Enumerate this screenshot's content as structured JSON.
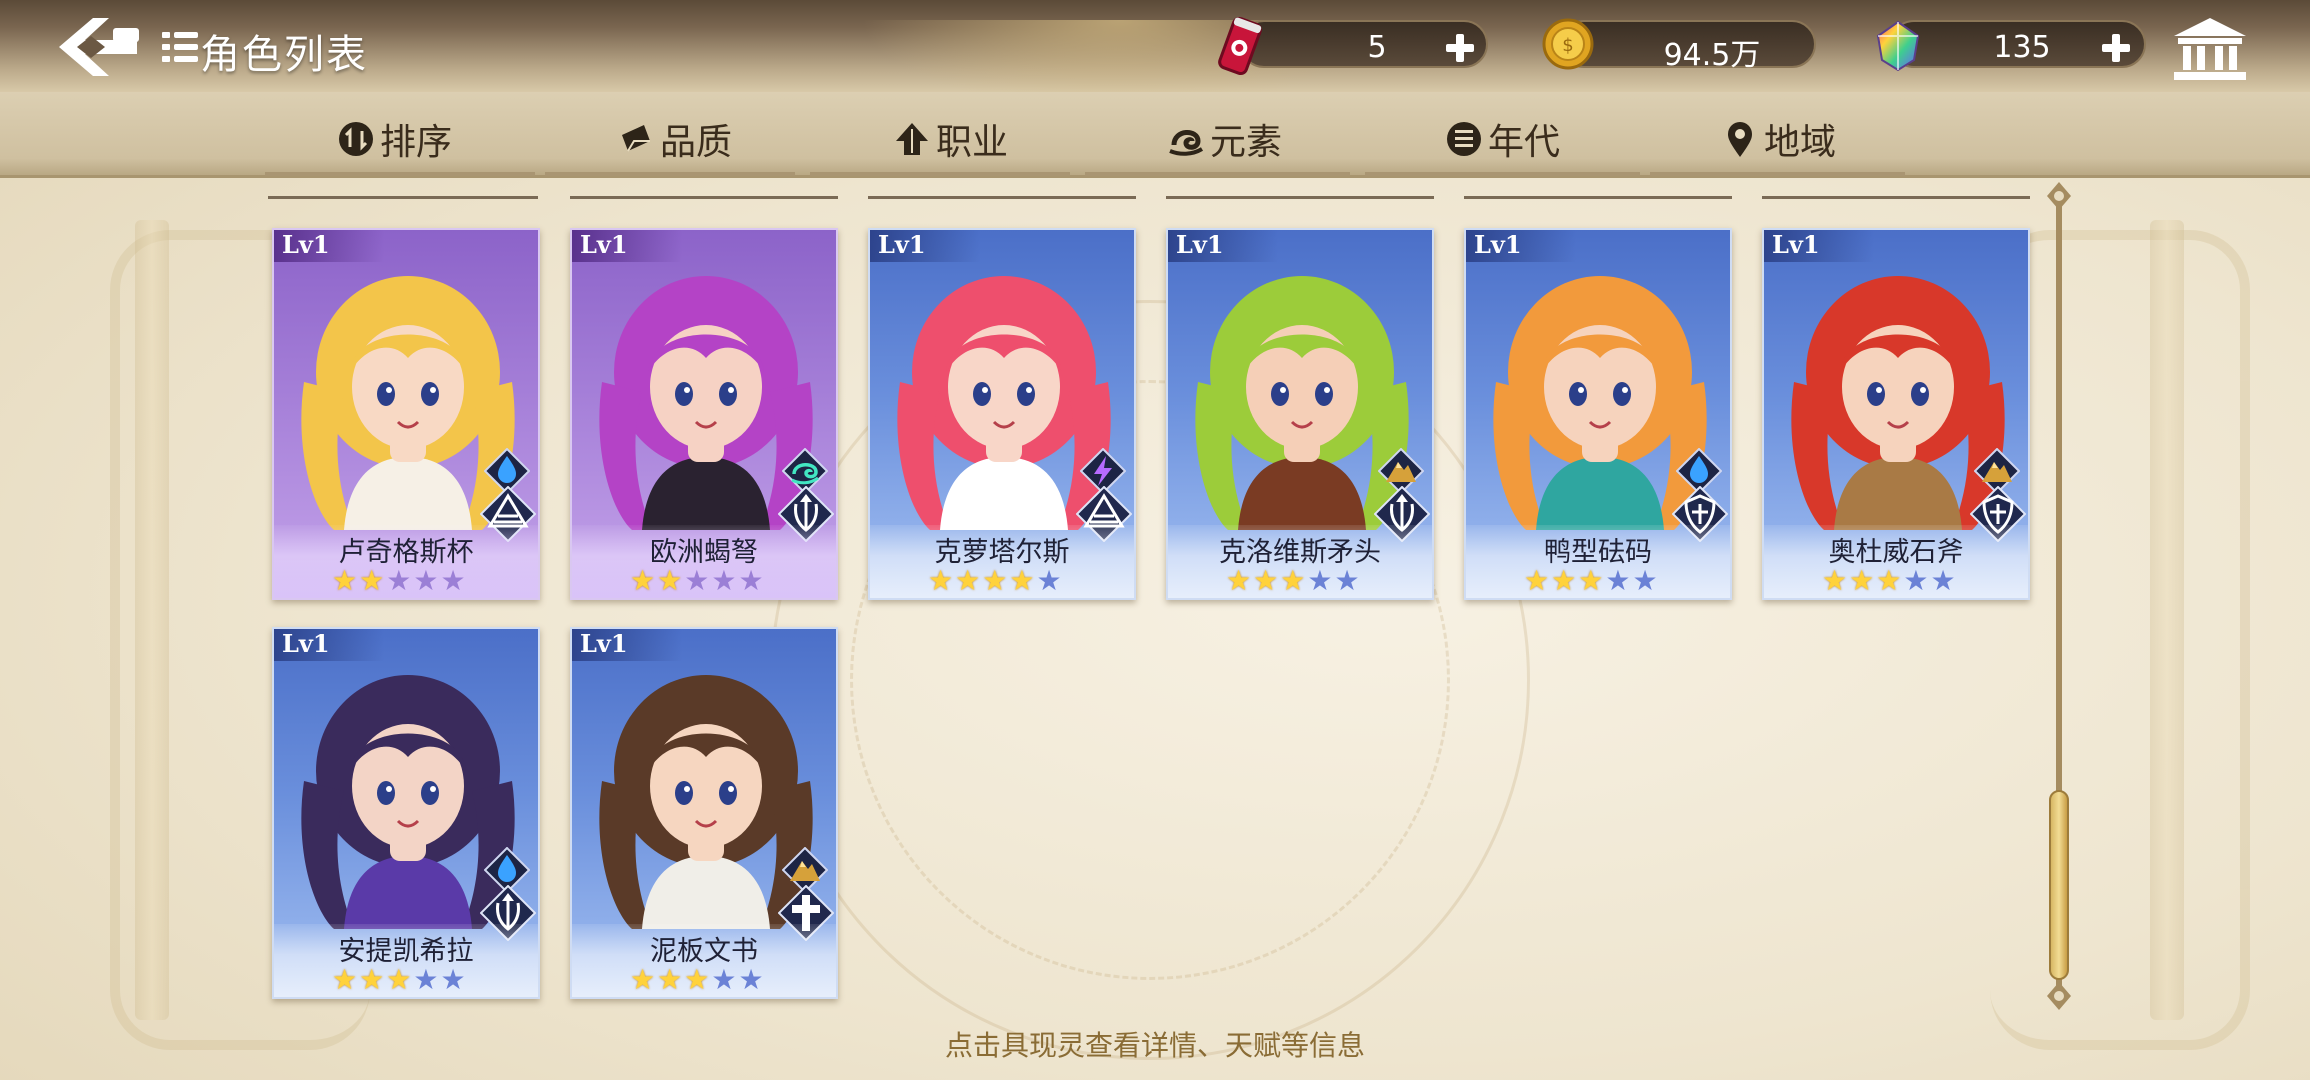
{
  "header": {
    "title": "角色列表",
    "resources": [
      {
        "name": "energy-drink",
        "value": "5"
      },
      {
        "name": "gold-coin",
        "value": "94.5万"
      },
      {
        "name": "gem",
        "value": "135"
      }
    ]
  },
  "filters": [
    {
      "label": "排序",
      "icon": "sort-icon"
    },
    {
      "label": "品质",
      "icon": "quality-icon"
    },
    {
      "label": "职业",
      "icon": "job-icon"
    },
    {
      "label": "元素",
      "icon": "element-icon"
    },
    {
      "label": "年代",
      "icon": "era-icon"
    },
    {
      "label": "地域",
      "icon": "region-location-icon"
    }
  ],
  "cards": [
    {
      "level": "Lv1",
      "name": "卢奇格斯杯",
      "stars": 2,
      "max_stars": 5,
      "rarity": "purple",
      "element": "water-drop-icon",
      "job": "mage-hat-icon",
      "hair": "#f3c54a",
      "skin": "#f8d9c4",
      "outfit": "#f6f0e6"
    },
    {
      "level": "Lv1",
      "name": "欧洲蝎弩",
      "stars": 2,
      "max_stars": 5,
      "rarity": "purple",
      "element": "wind-swirl-icon",
      "job": "archer-icon",
      "hair": "#b443c6",
      "skin": "#f6d2c4",
      "outfit": "#2a2230"
    },
    {
      "level": "Lv1",
      "name": "克萝塔尔斯",
      "stars": 4,
      "max_stars": 5,
      "rarity": "blue",
      "element": "lightning-icon",
      "job": "mage-hat-icon",
      "hair": "#ee4f6d",
      "skin": "#f8d6c8",
      "outfit": "#ffffff"
    },
    {
      "level": "Lv1",
      "name": "克洛维斯矛头",
      "stars": 3,
      "max_stars": 5,
      "rarity": "blue",
      "element": "earth-mountain-icon",
      "job": "archer-icon",
      "hair": "#9ccc3a",
      "skin": "#f5cfb7",
      "outfit": "#7a3b23"
    },
    {
      "level": "Lv1",
      "name": "鸭型砝码",
      "stars": 3,
      "max_stars": 5,
      "rarity": "blue",
      "element": "water-drop-icon",
      "job": "shield-guard-icon",
      "hair": "#f29a3c",
      "skin": "#f6d3bd",
      "outfit": "#2fa6a0"
    },
    {
      "level": "Lv1",
      "name": "奥杜威石斧",
      "stars": 3,
      "max_stars": 5,
      "rarity": "blue",
      "element": "earth-mountain-icon",
      "job": "shield-guard-icon",
      "hair": "#d8382a",
      "skin": "#f6d3bd",
      "outfit": "#a97a45"
    },
    {
      "level": "Lv1",
      "name": "安提凯希拉",
      "stars": 3,
      "max_stars": 5,
      "rarity": "blue",
      "element": "water-drop-icon",
      "job": "archer-icon",
      "hair": "#3a2b5c",
      "skin": "#f3d4c6",
      "outfit": "#5a3aa8"
    },
    {
      "level": "Lv1",
      "name": "泥板文书",
      "stars": 3,
      "max_stars": 5,
      "rarity": "blue",
      "element": "earth-mountain-icon",
      "job": "healer-cross-icon",
      "hair": "#5a3a28",
      "skin": "#f6d6c0",
      "outfit": "#f0eee8"
    }
  ],
  "hint": "点击具现灵查看详情、天赋等信息",
  "colors": {
    "accent_gold": "#d7b764",
    "topbar": "#6b5843",
    "text": "#3a2c1c"
  }
}
